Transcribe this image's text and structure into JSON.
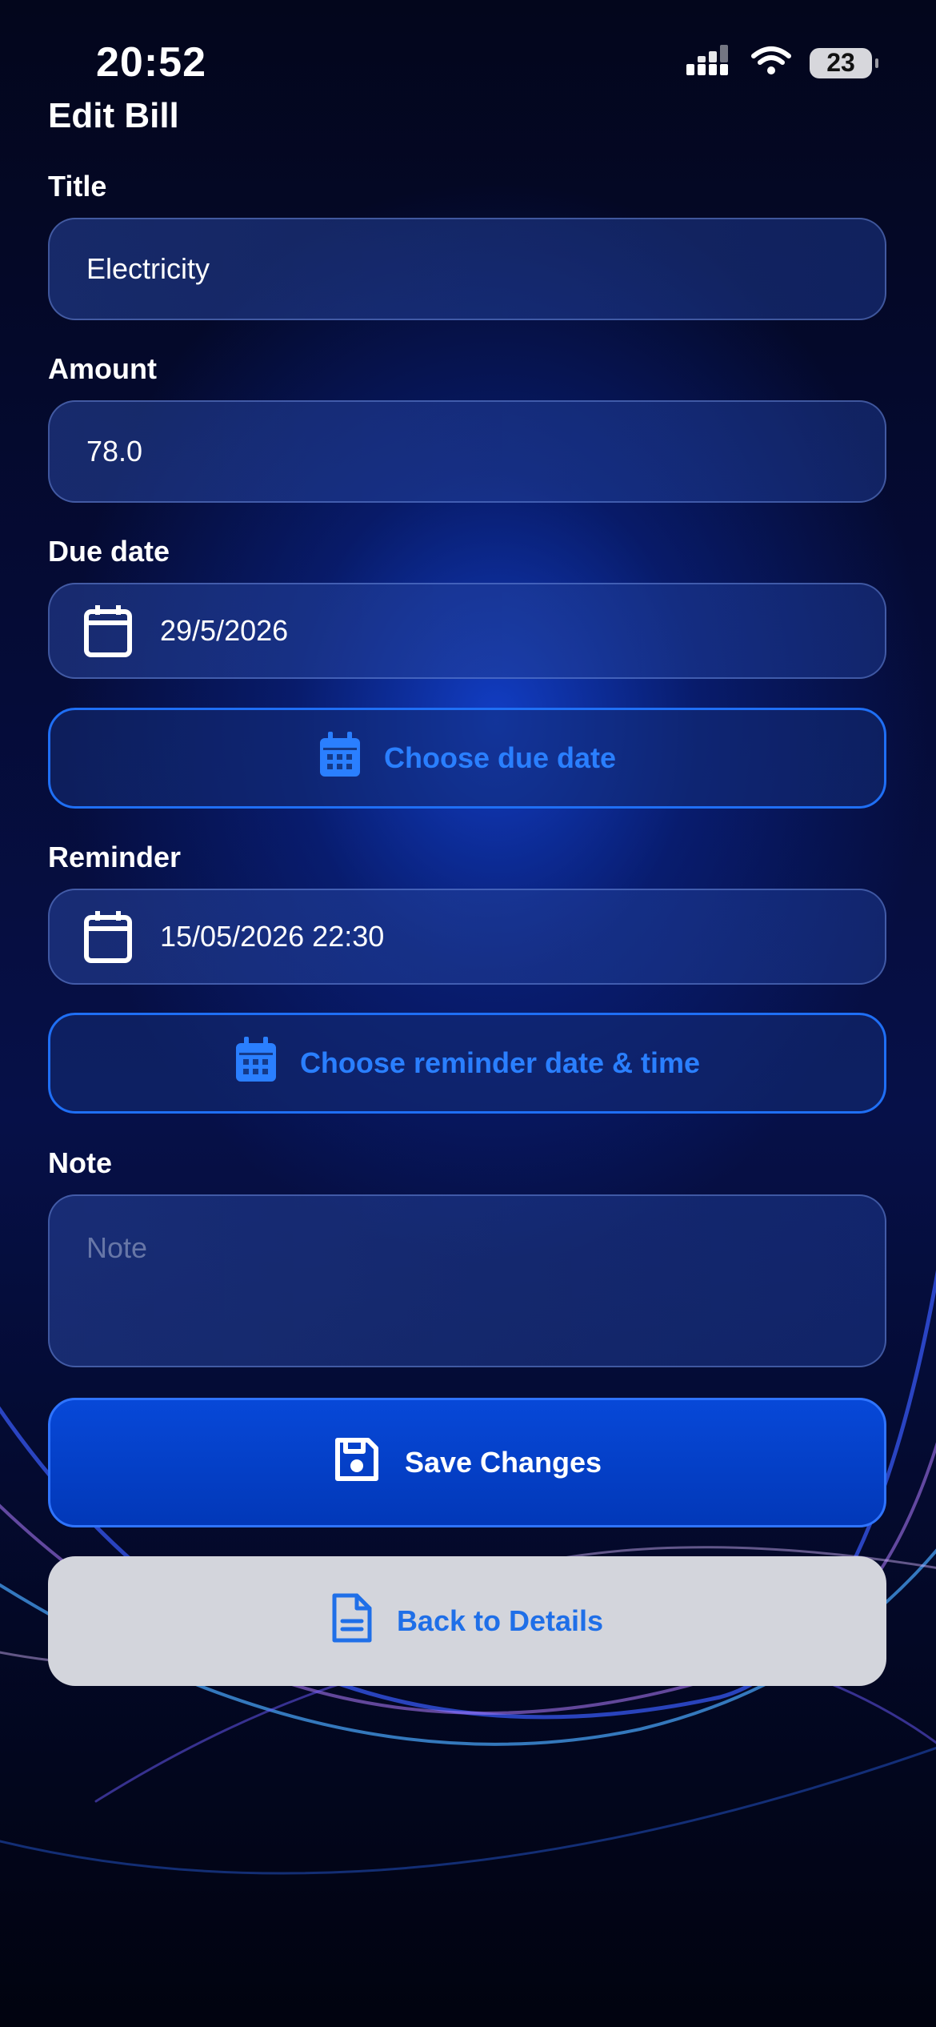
{
  "status_bar": {
    "time": "20:52",
    "battery": "23"
  },
  "page_title": "Edit Bill",
  "form": {
    "title_label": "Title",
    "title_value": "Electricity",
    "amount_label": "Amount",
    "amount_value": "78.0",
    "due_date_label": "Due date",
    "due_date_value": "29/5/2026",
    "choose_due_date": "Choose due date",
    "reminder_label": "Reminder",
    "reminder_value": "15/05/2026 22:30",
    "choose_reminder": "Choose reminder date & time",
    "note_label": "Note",
    "note_placeholder": "Note"
  },
  "actions": {
    "save_label": "Save Changes",
    "back_label": "Back to Details"
  },
  "icons": {
    "calendar": "calendar-icon",
    "calendar_filled": "calendar-filled-icon",
    "save": "floppy-disk-icon",
    "document": "document-icon",
    "signal": "cellular-signal-icon",
    "wifi": "wifi-icon"
  },
  "colors": {
    "accent": "#1f6ff5",
    "primary_button": "#0540c8",
    "secondary_button": "#d3d5dc",
    "background": "#020518"
  }
}
